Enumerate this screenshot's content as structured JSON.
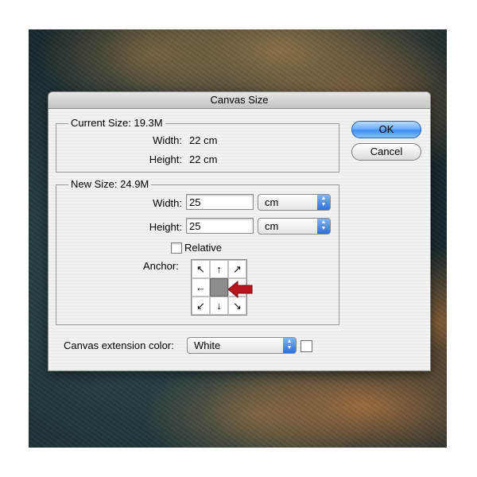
{
  "dialog": {
    "title": "Canvas Size"
  },
  "current_size": {
    "legend": "Current Size: 19.3M",
    "width_label": "Width:",
    "width_value": "22 cm",
    "height_label": "Height:",
    "height_value": "22 cm"
  },
  "new_size": {
    "legend": "New Size: 24.9M",
    "width_label": "Width:",
    "width_value": "25",
    "width_unit": "cm",
    "height_label": "Height:",
    "height_value": "25",
    "height_unit": "cm",
    "relative_label": "Relative",
    "relative_checked": false,
    "anchor_label": "Anchor:",
    "anchor_cells": [
      "↖",
      "↑",
      "↗",
      "←",
      "",
      "→",
      "↙",
      "↓",
      "↘"
    ]
  },
  "buttons": {
    "ok": "OK",
    "cancel": "Cancel"
  },
  "extension": {
    "label": "Canvas extension color:",
    "value": "White",
    "swatch_color": "#ffffff"
  },
  "annotation": {
    "arrow_color": "#b8141c"
  }
}
